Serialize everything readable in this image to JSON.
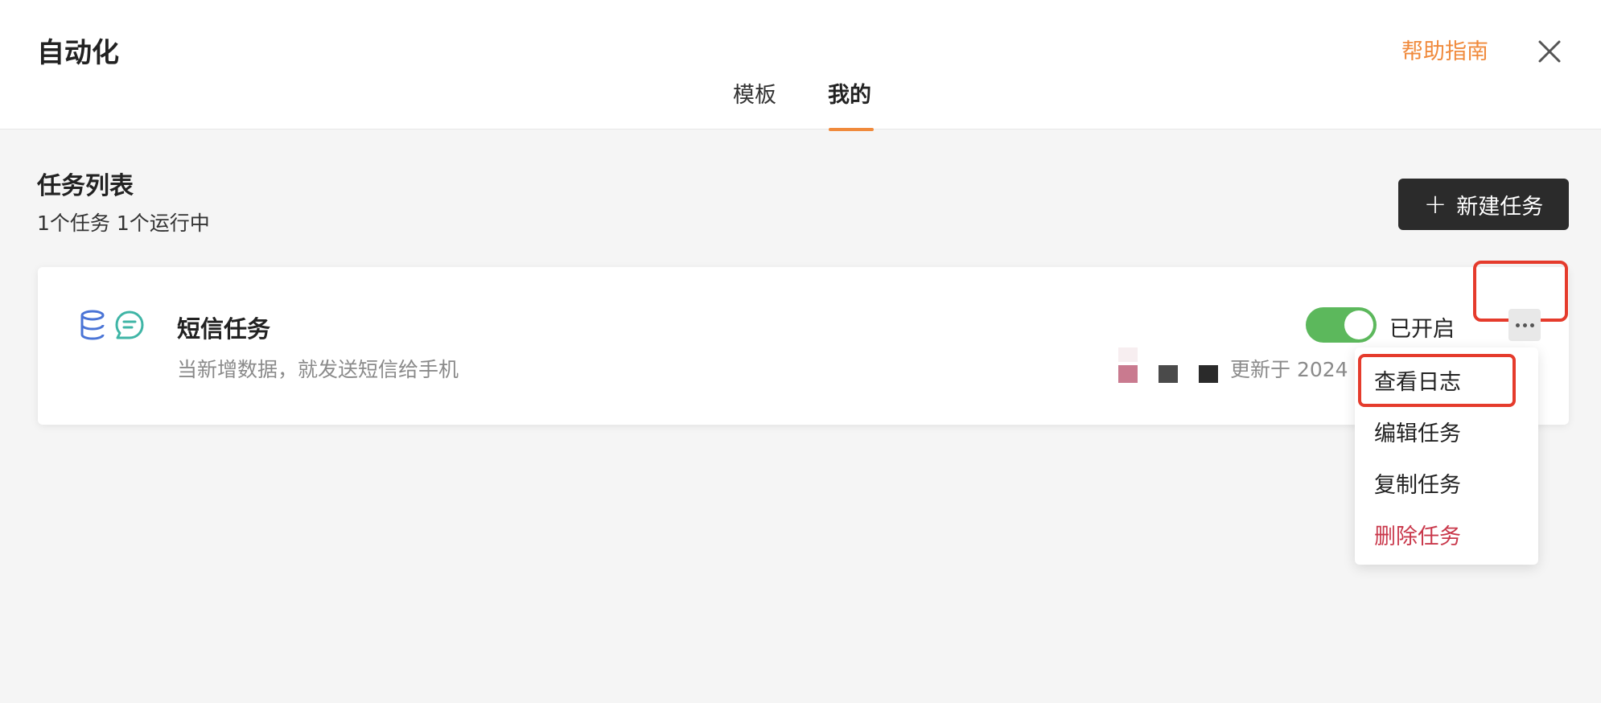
{
  "header": {
    "title": "自动化",
    "help_label": "帮助指南",
    "tabs": [
      {
        "label": "模板"
      },
      {
        "label": "我的"
      }
    ]
  },
  "list": {
    "title": "任务列表",
    "summary": "1个任务 1个运行中",
    "new_button_label": "新建任务"
  },
  "task": {
    "name": "短信任务",
    "description": "当新增数据，就发送短信给手机",
    "toggle_label": "已开启",
    "updated_label": "更新于 2024"
  },
  "menu": {
    "items": [
      {
        "label": "查看日志"
      },
      {
        "label": "编辑任务"
      },
      {
        "label": "复制任务"
      },
      {
        "label": "删除任务"
      }
    ]
  },
  "colors": {
    "accent": "#f08a3c",
    "toggle_on": "#5cb85c",
    "danger": "#c9384b",
    "highlight": "#e53b2c"
  }
}
